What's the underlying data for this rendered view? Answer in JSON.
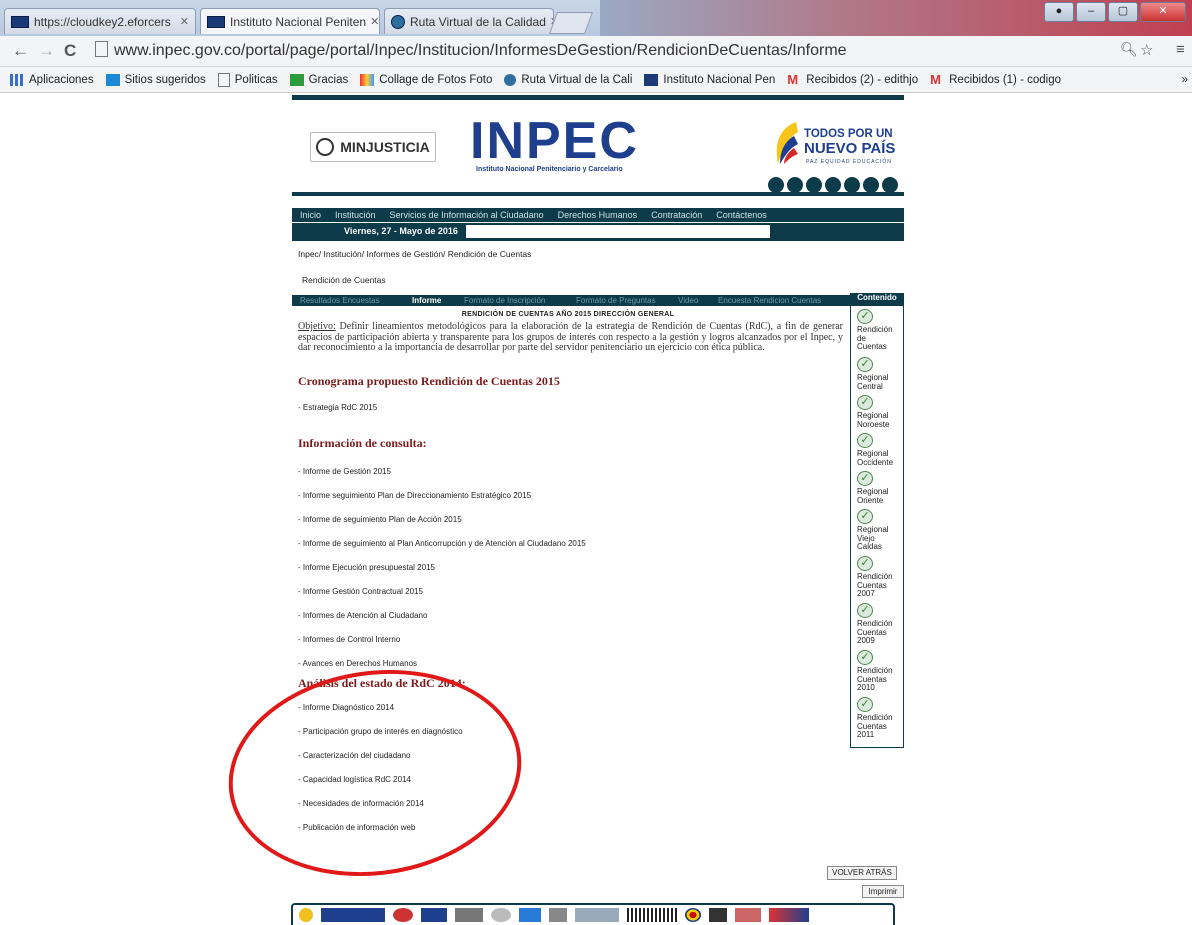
{
  "browser": {
    "tabs": [
      {
        "label": "https://cloudkey2.eforcers",
        "active": false
      },
      {
        "label": "Instituto Nacional Peniten",
        "active": true
      },
      {
        "label": "Ruta Virtual de la Calidad",
        "active": false
      }
    ],
    "url": "www.inpec.gov.co/portal/page/portal/Inpec/Institucion/InformesDeGestion/RendicionDeCuentas/Informe",
    "bookmarks": [
      "Aplicaciones",
      "Sitios sugeridos",
      "Politicas",
      "Gracias",
      "Collage de Fotos Foto",
      "Ruta Virtual de la Cali",
      "Instituto Nacional Pen",
      "Recibidos (2) - edithjo",
      "Recibidos (1) - codigo"
    ],
    "more": "»"
  },
  "header": {
    "minjusticia": "MINJUSTICIA",
    "logo": "INPEC",
    "logo_sub": "Instituto Nacional Penitenciario y Carcelario",
    "tpn_line1": "TODOS POR UN",
    "tpn_line2": "NUEVO PAÍS",
    "tpn_line3": "PAZ  EQUIDAD  EDUCACIÓN"
  },
  "nav": {
    "items": [
      "Inicio",
      "Institución",
      "Servicios de Información al Ciudadano",
      "Derechos Humanos",
      "Contratación",
      "Contáctenos"
    ],
    "date": "Viernes, 27 - Mayo de 2016"
  },
  "breadcrumb": "Inpec/ Institución/ Informes de Gestión/ Rendición de Cuentas",
  "page_title": "Rendición de Cuentas",
  "tabs": [
    {
      "label": "Resultados Encuestas",
      "active": false
    },
    {
      "label": "Informe",
      "active": true
    },
    {
      "label": "Formato de Inscripción",
      "active": false
    },
    {
      "label": "Formato de Preguntas",
      "active": false
    },
    {
      "label": "Video",
      "active": false
    },
    {
      "label": "Encuesta Rendicion Cuentas",
      "active": false
    }
  ],
  "content": {
    "heading": "RENDICIÓN DE CUENTAS AÑO 2015 DIRECCIÓN GENERAL",
    "objective_label": "Objetivo:",
    "objective_text": " Definir lineamientos metodológicos para la elaboración de la estrategia de Rendición de Cuentas (RdC), a fin de generar espacios de participación abierta y transparente para los grupos de interés con respecto a la gestión y logros alcanzados por el Inpec, y dar reconocimiento a la importancia de desarrollar por parte del servidor penitenciario un ejercicio con ética pública.",
    "sec1": "Cronograma propuesto Rendición de Cuentas 2015",
    "sec1_links": [
      "- Estrategia RdC 2015"
    ],
    "sec2": "Información de consulta:",
    "sec2_links": [
      "- Informe de Gestión 2015",
      "- Informe seguimiento Plan de Direccionamiento Estratégico 2015",
      "- Informe de seguimiento Plan de Acción 2015",
      "- Informe de seguimiento al Plan Anticorrupción y de Atención al Ciudadano 2015",
      "- Informe Ejecución presupuestal 2015",
      "- Informe Gestión Contractual 2015",
      "- Informes de Atención al Ciudadano",
      "- Informes de Control Interno",
      "- Avances en Derechos Humanos"
    ],
    "sec3": "Análisis del estado de RdC 2014:",
    "sec3_links": [
      "- Informe Diagnóstico 2014",
      "- Participación grupo de interés en diagnóstico",
      "- Caracterización del ciudadano",
      "- Capacidad logística RdC 2014",
      "- Necesidades de información 2014",
      "- Publicación de información web"
    ]
  },
  "sidebar": {
    "title": "Contenido",
    "items": [
      [
        "Rendición",
        "de",
        "Cuentas"
      ],
      [
        "Regional",
        "Central"
      ],
      [
        "Regional",
        "Noroeste"
      ],
      [
        "Regional",
        "Occidente"
      ],
      [
        "Regional",
        "Oriente"
      ],
      [
        "Regional",
        "Viejo",
        "Caldas"
      ],
      [
        "Rendición",
        "Cuentas",
        "2007"
      ],
      [
        "Rendición",
        "Cuentas",
        "2009"
      ],
      [
        "Rendición",
        "Cuentas",
        "2010"
      ],
      [
        "Rendición",
        "Cuentas",
        "2011"
      ]
    ]
  },
  "buttons": {
    "back": "VOLVER ATRÁS",
    "print": "Imprimir"
  },
  "colors": {
    "brand_dark": "#0d3b4a",
    "section_title": "#7a1a1a",
    "annotation_ellipse": "#e01818"
  }
}
